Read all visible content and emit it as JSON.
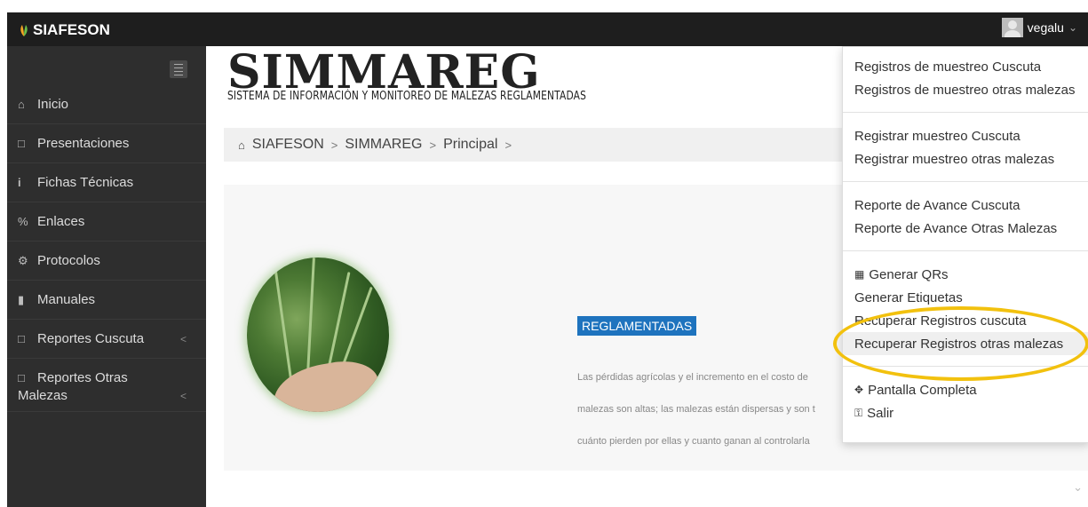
{
  "app": {
    "name": "SIAFESON"
  },
  "user": {
    "name": "vegalu"
  },
  "sidebar": {
    "items": [
      {
        "icon": "home-icon",
        "label": "Inicio"
      },
      {
        "icon": "folder-icon",
        "label": "Presentaciones"
      },
      {
        "icon": "info-icon",
        "label": "Fichas Técnicas"
      },
      {
        "icon": "link-icon",
        "label": "Enlaces"
      },
      {
        "icon": "gear-icon",
        "label": "Protocolos"
      },
      {
        "icon": "book-icon",
        "label": "Manuales"
      },
      {
        "icon": "file-icon",
        "label": "Reportes Cuscuta"
      },
      {
        "icon": "file-icon",
        "label_line1": "Reportes Otras",
        "label_line2": "Malezas"
      }
    ]
  },
  "banner": {
    "title": "SIMMAREG",
    "subtitle": "SISTEMA DE INFORMACIÓN Y MONITOREO DE MALEZAS REGLAMENTADAS"
  },
  "breadcrumb": [
    "SIAFESON",
    "SIMMAREG",
    "Principal"
  ],
  "feature": {
    "badge": "REGLAMENTADAS",
    "description_l1": "Las pérdidas agrícolas y el incremento en el costo de",
    "description_l2": "malezas son altas; las malezas están dispersas y son t",
    "description_l3": "cuánto pierden por ellas y cuanto ganan al controlarla"
  },
  "dropdown": {
    "group1": [
      "Registros de muestreo Cuscuta",
      "Registros de muestreo otras malezas"
    ],
    "group2": [
      "Registrar muestreo Cuscuta",
      "Registrar muestreo otras malezas"
    ],
    "group3": [
      "Reporte de Avance Cuscuta",
      "Reporte de Avance Otras Malezas"
    ],
    "group4": [
      "Generar QRs",
      "Generar Etiquetas",
      "Recuperar Registros cuscuta",
      "Recuperar Registros otras malezas"
    ],
    "group5": [
      "Pantalla Completa",
      "Salir"
    ]
  },
  "colors": {
    "accent": "#1e73be",
    "highlight": "#f2c10e",
    "sidebar": "#2e2e2e",
    "topbar": "#1e1e1e"
  }
}
